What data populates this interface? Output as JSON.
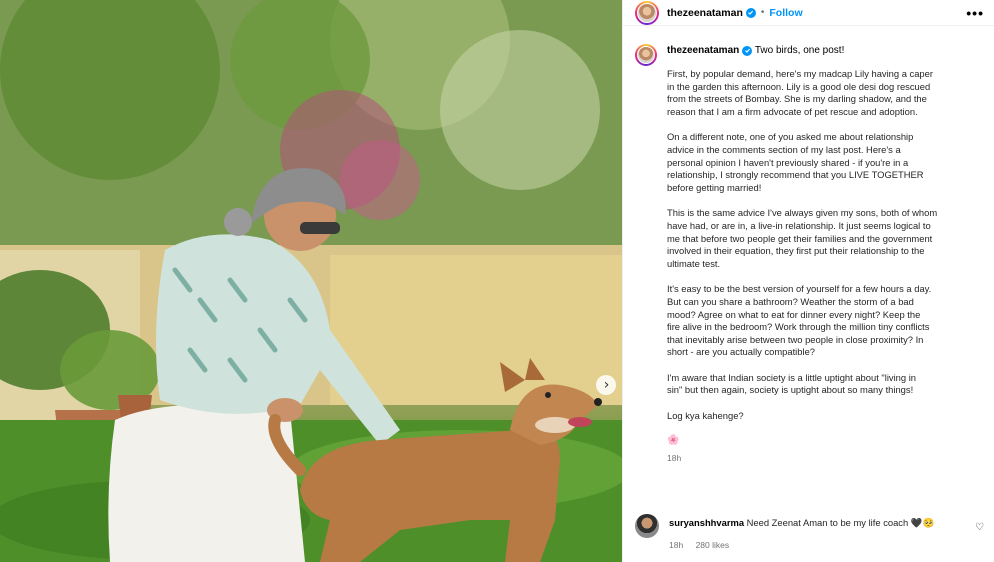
{
  "post": {
    "author": "thezeenataman",
    "follow_label": "Follow",
    "dot": "•",
    "more_label": "•••",
    "next_label": "›"
  },
  "caption": {
    "author": "thezeenataman",
    "title": "Two birds, one post!",
    "paragraphs": [
      "First, by popular demand, here's my madcap Lily having a caper\nin the garden this afternoon. Lily is a good ole desi dog rescued\nfrom the streets of Bombay. She is my darling shadow, and the\nreason that I am a firm advocate of pet rescue and adoption.",
      "On a different note, one of you asked me about relationship\nadvice in the comments section of my last post. Here's a\npersonal opinion I haven't previously shared - if you're in a\nrelationship, I strongly recommend that you LIVE TOGETHER\nbefore getting married!",
      "This is the same advice I've always given my sons, both of whom\nhave had, or are in, a live-in relationship. It just seems logical to\nme that before two people get their families and the government\ninvolved in their equation, they first put their relationship to the\nultimate test.",
      "It's easy to be the best version of yourself for a few hours a day.\nBut can you share a bathroom? Weather the storm of a bad\nmood? Agree on what to eat for dinner every night? Keep the\nfire alive in the bedroom? Work through the million tiny conflicts\nthat inevitably arise between two people in close proximity? In\nshort - are you actually compatible?",
      "I'm aware that Indian society is a little uptight about \"living in\nsin\" but then again, society is uptight about so many things!",
      "Log kya kahenge?"
    ],
    "emoji": "🌸",
    "time": "18h"
  },
  "comment": {
    "author": "suryanshhvarma",
    "text": "Need Zeenat Aman to be my life coach 🖤🥺",
    "time": "18h",
    "likes": "280 likes",
    "heart": "♡"
  },
  "colors": {
    "accent": "#0095f6",
    "muted": "#737373",
    "border": "#efefef"
  }
}
